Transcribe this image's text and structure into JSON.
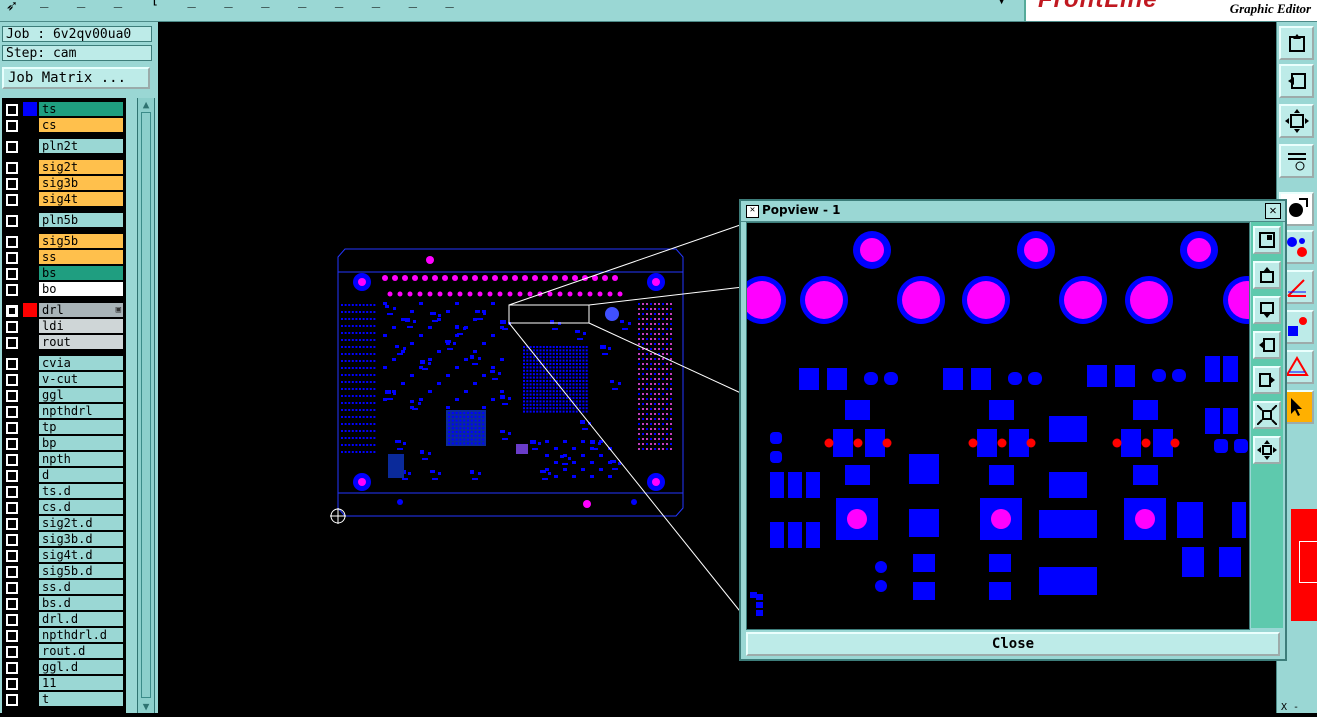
{
  "app": {
    "brand": "FrontLine",
    "subtitle": "Graphic Editor"
  },
  "job_info": {
    "job": "Job : 6v2qv00ua0",
    "step": "Step: cam",
    "job_matrix_button": "Job Matrix ..."
  },
  "layers": [
    {
      "name": "ts",
      "color": "#1f9e80",
      "swatch": "#0000ff"
    },
    {
      "name": "cs",
      "color": "#ffc04c",
      "swatch": null
    },
    {
      "name": "pln2t",
      "color": "#9ad7d4",
      "swatch": null
    },
    {
      "name": "sig2t",
      "color": "#ffc04c",
      "swatch": null
    },
    {
      "name": "sig3b",
      "color": "#ffc04c",
      "swatch": null
    },
    {
      "name": "sig4t",
      "color": "#ffc04c",
      "swatch": null
    },
    {
      "name": "pln5b",
      "color": "#9ad7d4",
      "swatch": null
    },
    {
      "name": "sig5b",
      "color": "#ffc04c",
      "swatch": null
    },
    {
      "name": "ss",
      "color": "#ffc04c",
      "swatch": null
    },
    {
      "name": "bs",
      "color": "#1f9e80",
      "swatch": null
    },
    {
      "name": "bo",
      "color": "#ffffff",
      "swatch": null
    },
    {
      "name": "drl",
      "color": "#a9b4b8",
      "swatch": "#ff0000",
      "active": true,
      "mark": "▣"
    },
    {
      "name": "ldi",
      "color": "#cfd6d7",
      "swatch": null
    },
    {
      "name": "rout",
      "color": "#cfd6d7",
      "swatch": null
    },
    {
      "name": "cvia",
      "color": "#9ad7d4",
      "swatch": null
    },
    {
      "name": "v-cut",
      "color": "#9ad7d4",
      "swatch": null
    },
    {
      "name": "ggl",
      "color": "#9ad7d4",
      "swatch": null
    },
    {
      "name": "npthdrl",
      "color": "#9ad7d4",
      "swatch": null
    },
    {
      "name": "tp",
      "color": "#9ad7d4",
      "swatch": null
    },
    {
      "name": "bp",
      "color": "#9ad7d4",
      "swatch": null
    },
    {
      "name": "npth",
      "color": "#9ad7d4",
      "swatch": null
    },
    {
      "name": "d",
      "color": "#9ad7d4",
      "swatch": null
    },
    {
      "name": "ts.d",
      "color": "#9ad7d4",
      "swatch": null
    },
    {
      "name": "cs.d",
      "color": "#9ad7d4",
      "swatch": null
    },
    {
      "name": "sig2t.d",
      "color": "#9ad7d4",
      "swatch": null
    },
    {
      "name": "sig3b.d",
      "color": "#9ad7d4",
      "swatch": null
    },
    {
      "name": "sig4t.d",
      "color": "#9ad7d4",
      "swatch": null
    },
    {
      "name": "sig5b.d",
      "color": "#9ad7d4",
      "swatch": null
    },
    {
      "name": "ss.d",
      "color": "#9ad7d4",
      "swatch": null
    },
    {
      "name": "bs.d",
      "color": "#9ad7d4",
      "swatch": null
    },
    {
      "name": "drl.d",
      "color": "#9ad7d4",
      "swatch": null
    },
    {
      "name": "npthdrl.d",
      "color": "#9ad7d4",
      "swatch": null
    },
    {
      "name": "rout.d",
      "color": "#9ad7d4",
      "swatch": null
    },
    {
      "name": "ggl.d",
      "color": "#9ad7d4",
      "swatch": null
    },
    {
      "name": "11",
      "color": "#9ad7d4",
      "swatch": null
    },
    {
      "name": "t",
      "color": "#9ad7d4",
      "swatch": null
    }
  ],
  "popview": {
    "title": "Popview - 1",
    "close_label": "Close"
  },
  "status": {
    "coord_label": "X -"
  },
  "colors": {
    "panel": "#9ad7d4",
    "pad": "#0000ff",
    "drill": "#ff00ff",
    "hit": "#ff0000",
    "outline": "#ffffff"
  }
}
